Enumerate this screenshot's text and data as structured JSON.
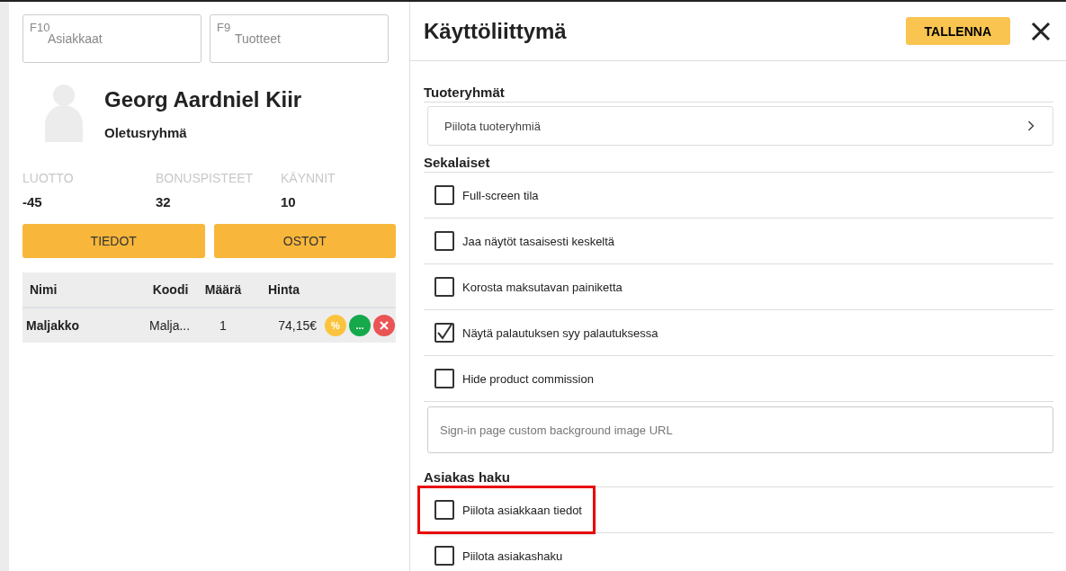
{
  "shortcuts": [
    {
      "key": "F10",
      "label": "Asiakkaat"
    },
    {
      "key": "F9",
      "label": "Tuotteet"
    }
  ],
  "customer": {
    "name": "Georg Aardniel Kiir",
    "group": "Oletusryhmä"
  },
  "stats": [
    {
      "label": "LUOTTO",
      "value": "-45"
    },
    {
      "label": "BONUSPISTEET",
      "value": "32"
    },
    {
      "label": "KÄYNNIT",
      "value": "10"
    }
  ],
  "customer_buttons": [
    {
      "label": "TIEDOT"
    },
    {
      "label": "OSTOT"
    }
  ],
  "table": {
    "columns": [
      "Nimi",
      "Koodi",
      "Määrä",
      "Hinta"
    ],
    "rows": [
      {
        "cells": [
          "Maljakko",
          "Malja...",
          "1",
          "74,15€"
        ],
        "actions": [
          {
            "kind": "discount",
            "label": "%"
          },
          {
            "kind": "more",
            "label": "..."
          },
          {
            "kind": "remove"
          }
        ]
      }
    ]
  },
  "panel": {
    "title": "Käyttöliittymä",
    "save": "TALLENNA",
    "sections": [
      {
        "heading": "Tuoteryhmät",
        "items": [
          {
            "kind": "link",
            "label": "Piilota tuoteryhmiä"
          }
        ]
      },
      {
        "heading": "Sekalaiset",
        "items": [
          {
            "kind": "checkbox",
            "label": "Full-screen tila",
            "checked": false,
            "highlighted": false
          },
          {
            "kind": "checkbox",
            "label": "Jaa näytöt tasaisesti keskeltä",
            "checked": false,
            "highlighted": false
          },
          {
            "kind": "checkbox",
            "label": "Korosta maksutavan painiketta",
            "checked": false,
            "highlighted": false
          },
          {
            "kind": "checkbox",
            "label": "Näytä palautuksen syy palautuksessa",
            "checked": true,
            "highlighted": false
          },
          {
            "kind": "checkbox",
            "label": "Hide product commission",
            "checked": false,
            "highlighted": false
          },
          {
            "kind": "input",
            "placeholder": "Sign-in page custom background image URL"
          }
        ]
      },
      {
        "heading": "Asiakas haku",
        "items": [
          {
            "kind": "checkbox",
            "label": "Piilota asiakkaan tiedot",
            "checked": false,
            "highlighted": true
          },
          {
            "kind": "checkbox",
            "label": "Piilota asiakashaku",
            "checked": false,
            "highlighted": false
          }
        ]
      }
    ]
  }
}
